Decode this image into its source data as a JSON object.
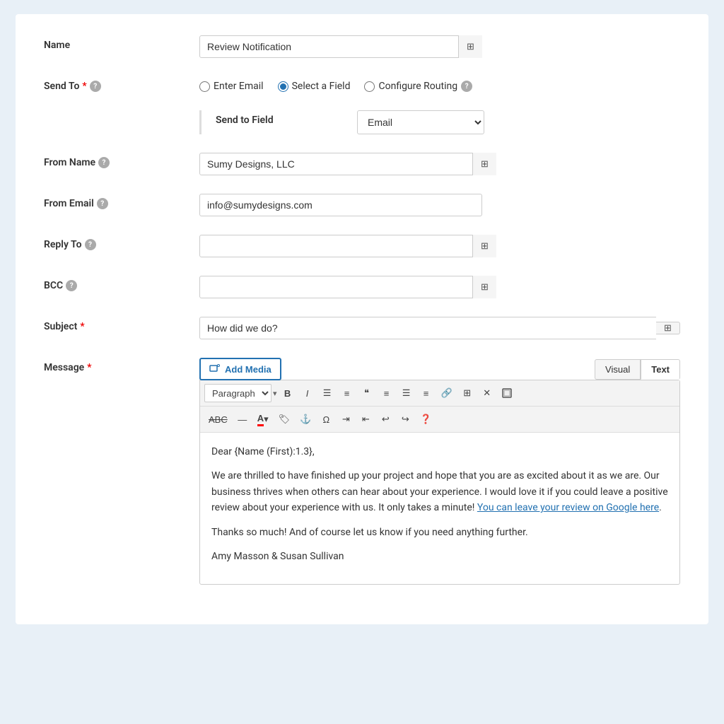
{
  "form": {
    "name_label": "Name",
    "name_value": "Review Notification",
    "send_to_label": "Send To",
    "send_to_required": "*",
    "radio_options": [
      {
        "id": "enter-email",
        "label": "Enter Email",
        "checked": false
      },
      {
        "id": "select-field",
        "label": "Select a Field",
        "checked": true
      },
      {
        "id": "configure-routing",
        "label": "Configure Routing",
        "checked": false
      }
    ],
    "send_to_field_label": "Send to Field",
    "send_to_field_value": "Email",
    "from_name_label": "From Name",
    "from_name_value": "Sumy Designs, LLC",
    "from_email_label": "From Email",
    "from_email_value": "info@sumydesigns.com",
    "reply_to_label": "Reply To",
    "reply_to_value": "",
    "bcc_label": "BCC",
    "bcc_value": "",
    "subject_label": "Subject",
    "subject_required": "*",
    "subject_value": "How did we do?",
    "message_label": "Message",
    "message_required": "*",
    "add_media_label": "Add Media",
    "view_visual": "Visual",
    "view_text": "Text",
    "paragraph_select": "Paragraph",
    "message_body_line1": "Dear {Name (First):1.3},",
    "message_body_line2": "We are thrilled to have finished up your project and hope that you are as excited about it as we are. Our business thrives when others can hear about your experience. I would love it if you could leave a positive review about your experience with us. It only takes a minute!",
    "message_link_text": "You can leave your review on Google here",
    "message_body_line3": ".",
    "message_body_line4": "Thanks so much! And of course let us know if you need anything further.",
    "message_body_line5": "Amy Masson & Susan Sullivan"
  }
}
